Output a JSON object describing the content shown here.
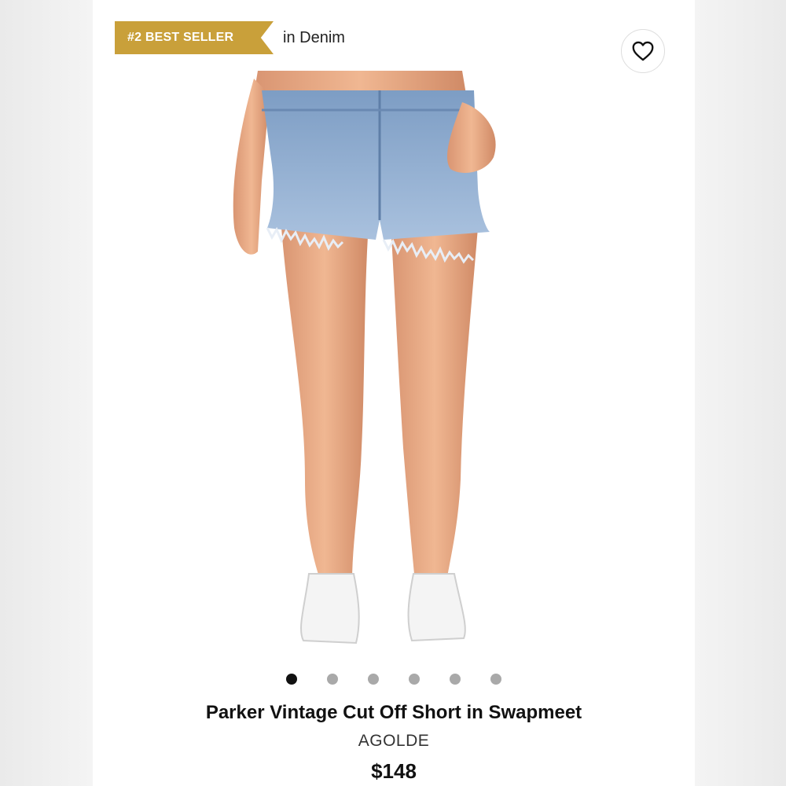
{
  "badge": {
    "label": "#2 BEST SELLER",
    "category": "in Denim",
    "color": "#c9a03a"
  },
  "favorite": {
    "icon": "heart-icon"
  },
  "product": {
    "title": "Parker Vintage Cut Off Short in Swapmeet",
    "brand": "AGOLDE",
    "price": "$148",
    "image": "denim-cutoff-shorts-model-photo"
  },
  "carousel": {
    "total": 6,
    "active_index": 0
  }
}
